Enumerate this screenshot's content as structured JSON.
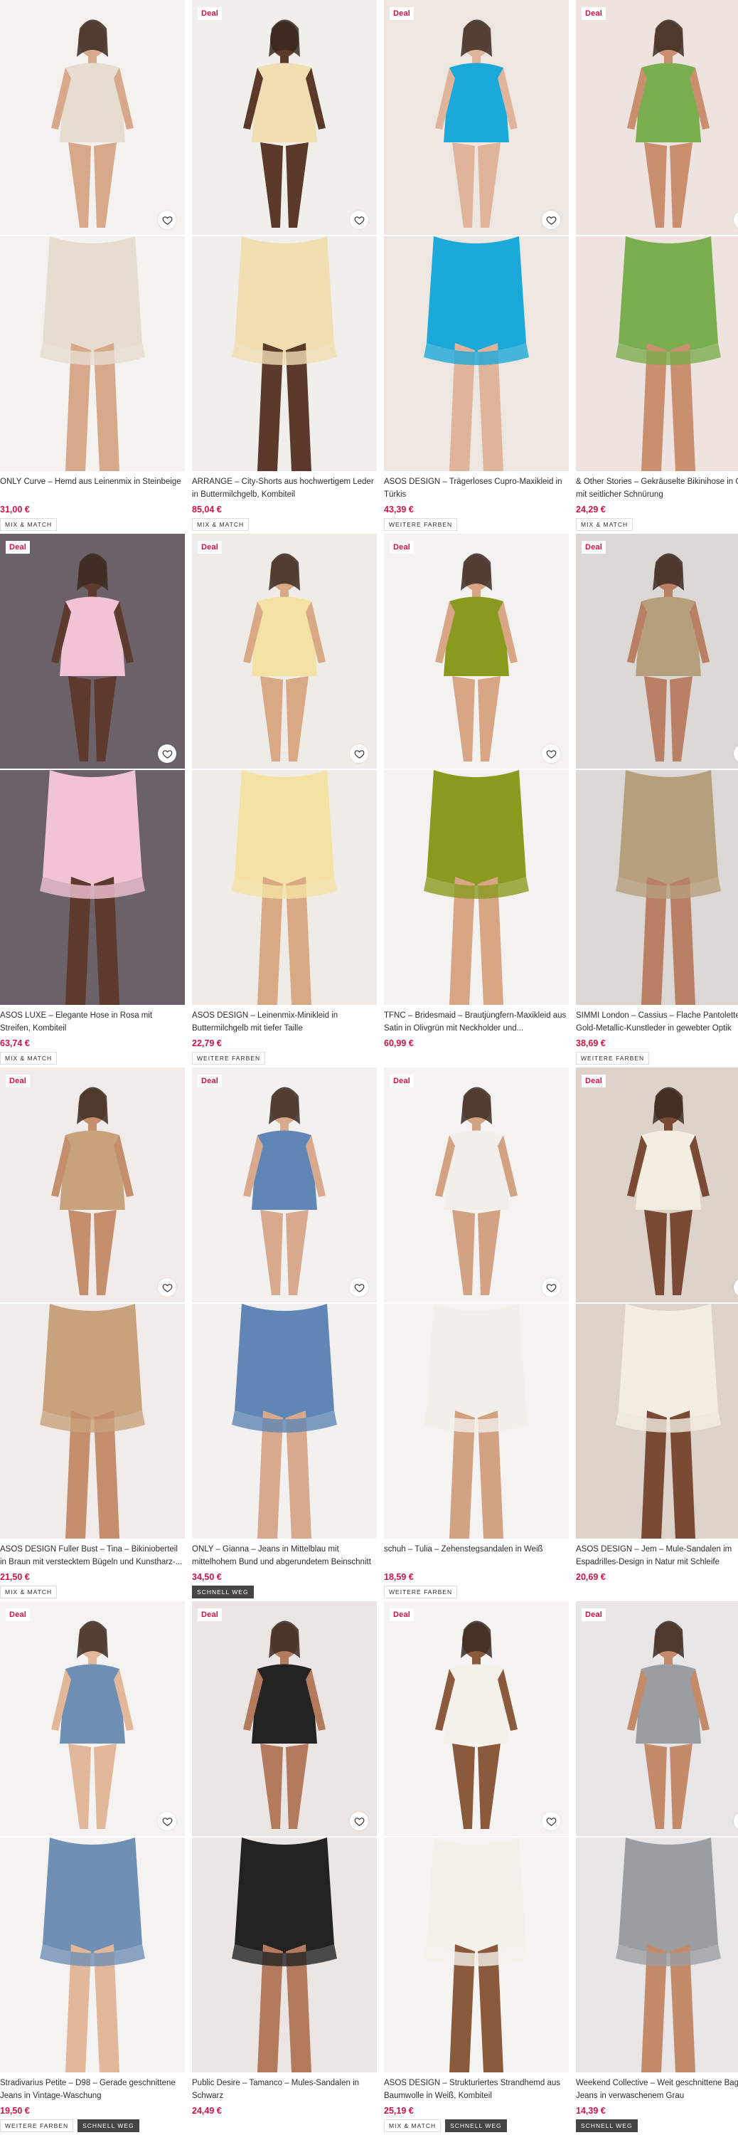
{
  "labels": {
    "deal": "Deal",
    "mix_match": "MIX & MATCH",
    "more_colors": "WEITERE FARBEN",
    "selling_fast": "SCHNELL WEG"
  },
  "products": [
    {
      "title": "ONLY Curve – Hemd aus Leinenmix in Steinbeige",
      "price": "31,00 €",
      "deal": false,
      "tags": [
        "MIX & MATCH"
      ],
      "colors": {
        "bg": "#f4f1ee",
        "item": "#e6ddd0",
        "skin": "#d7a88a"
      }
    },
    {
      "title": "ARRANGE – City-Shorts aus hochwertigem Leder in Buttermilchgelb, Kombiteil",
      "price": "85,04 €",
      "deal": true,
      "tags": [
        "MIX & MATCH"
      ],
      "colors": {
        "bg": "#f1efec",
        "item": "#f1dfb3",
        "skin": "#5b3a2a"
      }
    },
    {
      "title": "ASOS DESIGN – Trägerloses Cupro-Maxikleid in Türkis",
      "price": "43,39 €",
      "deal": true,
      "tags": [
        "WEITERE FARBEN"
      ],
      "colors": {
        "bg": "#ede6e1",
        "item": "#1aa9d8",
        "skin": "#e0b49a"
      }
    },
    {
      "title": "& Other Stories – Gekräuselte Bikinihose in Grün mit seitlicher Schnürung",
      "price": "24,29 €",
      "deal": true,
      "tags": [
        "MIX & MATCH"
      ],
      "colors": {
        "bg": "#eee3df",
        "item": "#7aae4e",
        "skin": "#c98f6e"
      }
    },
    {
      "title": "ASOS LUXE – Elegante Hose in Rosa mit Streifen, Kombiteil",
      "price": "63,74 €",
      "deal": true,
      "tags": [
        "MIX & MATCH"
      ],
      "colors": {
        "bg": "#6a6268",
        "item": "#f2c3d5",
        "skin": "#5e3a2e"
      }
    },
    {
      "title": "ASOS DESIGN – Leinenmix-Minikleid in Buttermilchgelb mit tiefer Taille",
      "price": "22,79 €",
      "deal": true,
      "tags": [
        "WEITERE FARBEN"
      ],
      "colors": {
        "bg": "#efece7",
        "item": "#f4e2a4",
        "skin": "#d9a986"
      }
    },
    {
      "title": "TFNC – Bridesmaid – Brautjungfern-Maxikleid aus Satin in Olivgrün mit Neckholder und...",
      "price": "60,99 €",
      "deal": true,
      "tags": [],
      "colors": {
        "bg": "#f3f2f1",
        "item": "#8a9a1e",
        "skin": "#d8a585"
      }
    },
    {
      "title": "SIMMI London – Cassius – Flache Pantoletten aus Gold-Metallic-Kunstleder in gewebter Optik",
      "price": "38,69 €",
      "deal": true,
      "tags": [
        "WEITERE FARBEN"
      ],
      "colors": {
        "bg": "#dcd8d6",
        "item": "#b69f7d",
        "skin": "#b98065"
      }
    },
    {
      "title": "ASOS DESIGN Fuller Bust – Tina – Bikinioberteil in Braun mit verstecktem Bügeln und Kunstharz-...",
      "price": "21,50 €",
      "deal": true,
      "tags": [
        "MIX & MATCH"
      ],
      "colors": {
        "bg": "#f1ece9",
        "item": "#c8a27c",
        "skin": "#c58e6c"
      }
    },
    {
      "title": "ONLY – Gianna – Jeans in Mittelblau mit mittelhohem Bund und abgerundetem Beinschnitt",
      "price": "34,50 €",
      "deal": true,
      "tags": [
        "SCHNELL WEG"
      ],
      "colors": {
        "bg": "#f2f1f0",
        "item": "#5f86b4",
        "skin": "#d8a98d"
      }
    },
    {
      "title": "schuh – Tulia – Zehenstegsandalen in Weiß",
      "price": "18,59 €",
      "deal": true,
      "tags": [
        "WEITERE FARBEN"
      ],
      "colors": {
        "bg": "#f5f3f1",
        "item": "#f2efea",
        "skin": "#d2a283"
      }
    },
    {
      "title": "ASOS DESIGN – Jem – Mule-Sandalen im Espadrilles-Design in Natur mit Schleife",
      "price": "20,69 €",
      "deal": true,
      "tags": [],
      "colors": {
        "bg": "#ddd3cb",
        "item": "#f3ede2",
        "skin": "#7b4a34"
      }
    },
    {
      "title": "Stradivarius Petite – D98 – Gerade geschnittene Jeans in Vintage-Waschung",
      "price": "19,50 €",
      "deal": true,
      "tags": [
        "WEITERE FARBEN",
        "SCHNELL WEG"
      ],
      "colors": {
        "bg": "#f4f3f2",
        "item": "#6f8fb5",
        "skin": "#e2b79a"
      }
    },
    {
      "title": "Public Desire – Tamanco – Mules-Sandalen in Schwarz",
      "price": "24,49 €",
      "deal": true,
      "tags": [],
      "colors": {
        "bg": "#ebe6e3",
        "item": "#222222",
        "skin": "#b47a5d"
      }
    },
    {
      "title": "ASOS DESIGN – Strukturiertes Strandhemd aus Baumwolle in Weiß, Kombiteil",
      "price": "25,19 €",
      "deal": true,
      "tags": [
        "MIX & MATCH",
        "SCHNELL WEG"
      ],
      "colors": {
        "bg": "#f5f4f2",
        "item": "#f4f1ea",
        "skin": "#8b5a3d"
      }
    },
    {
      "title": "Weekend Collective – Weit geschnittene Baggy-Jeans in verwaschenem Grau",
      "price": "14,39 €",
      "deal": true,
      "tags": [
        "SCHNELL WEG"
      ],
      "colors": {
        "bg": "#e8e6e7",
        "item": "#9a9ea3",
        "skin": "#c48b6b"
      }
    }
  ]
}
